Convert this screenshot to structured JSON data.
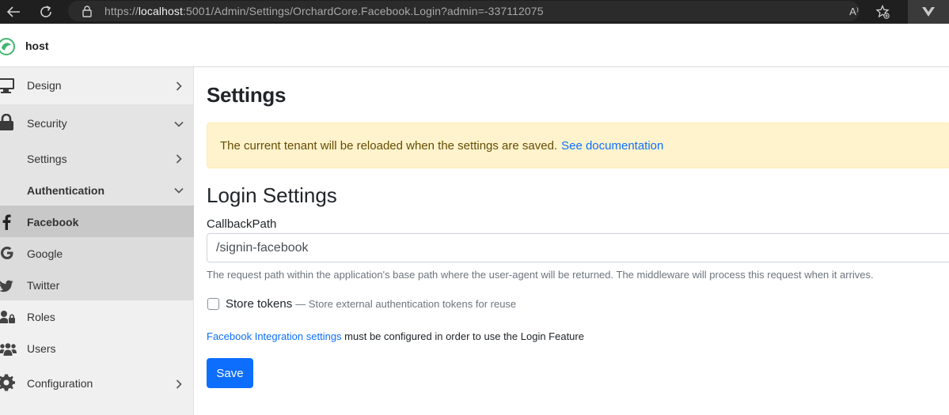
{
  "browser": {
    "url_prefix": "https://",
    "url_host": "localhost",
    "url_rest": ":5001/Admin/Settings/OrchardCore.Facebook.Login?admin=-337112075",
    "read_aloud_label": "A⁾"
  },
  "topbar": {
    "brand": "host"
  },
  "sidebar": {
    "items": [
      {
        "label": "Design"
      },
      {
        "label": "Security"
      },
      {
        "label": "Settings"
      },
      {
        "label": "Authentication"
      },
      {
        "label": "Facebook"
      },
      {
        "label": "Google"
      },
      {
        "label": "Twitter"
      },
      {
        "label": "Roles"
      },
      {
        "label": "Users"
      },
      {
        "label": "Configuration"
      }
    ]
  },
  "main": {
    "title": "Settings",
    "alert_text": "The current tenant will be reloaded when the settings are saved.",
    "alert_link": "See documentation",
    "section_title": "Login Settings",
    "callback_label": "CallbackPath",
    "callback_value": "/signin-facebook",
    "callback_hint": "The request path within the application's base path where the user-agent will be returned. The middleware will process this request when it arrives.",
    "store_tokens_label": "Store tokens",
    "store_tokens_hint": "— Store external authentication tokens for reuse",
    "note_link": "Facebook Integration settings",
    "note_text": " must be configured in order to use the Login Feature",
    "save_label": "Save"
  },
  "colors": {
    "primary": "#0d6efd",
    "alert_bg": "#fff3cd",
    "sidebar_bg": "#f0f0f0",
    "active_bg": "#c8c8c8"
  }
}
